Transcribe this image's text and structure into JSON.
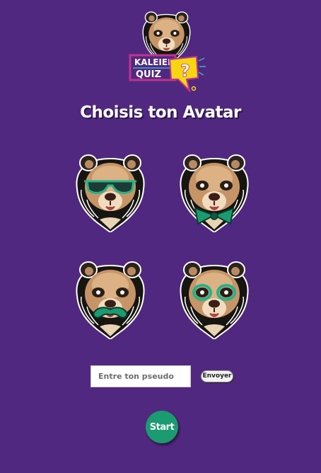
{
  "logo": {
    "line1": "KALEIEN",
    "line2": "QUIZ",
    "mark": "?"
  },
  "title": "Choisis ton Avatar",
  "avatars": [
    {
      "name": "bear-sunglasses-icon"
    },
    {
      "name": "bear-bowtie-icon"
    },
    {
      "name": "bear-mustache-icon"
    },
    {
      "name": "bear-eye-patch-icon"
    }
  ],
  "form": {
    "pseudo_placeholder": "Entre ton pseudo",
    "send_label": "Envoyer"
  },
  "start_label": "Start",
  "colors": {
    "background": "#51287f",
    "accent": "#1a9b70",
    "logo_yellow": "#f6d70f",
    "logo_pink": "#c0338f"
  }
}
